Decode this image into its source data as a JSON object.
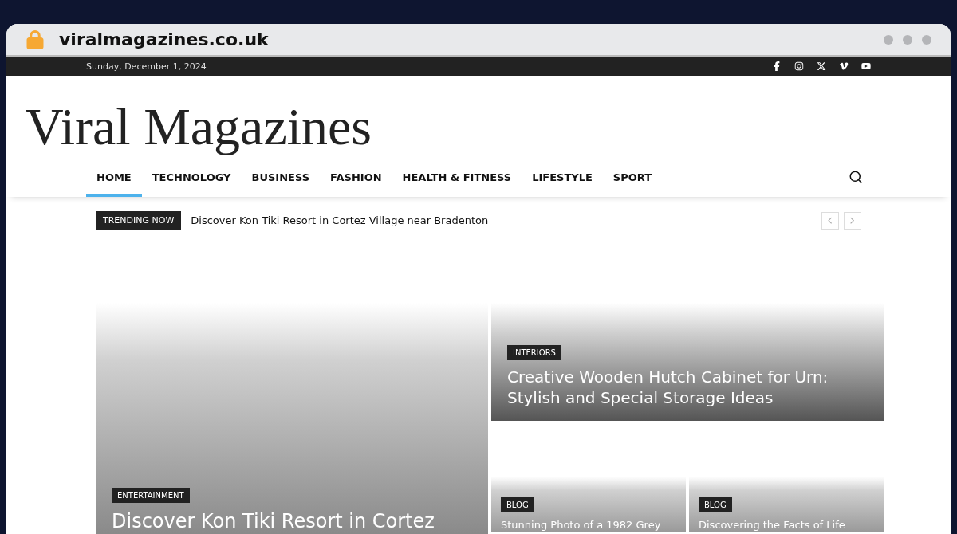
{
  "browser": {
    "address": "viralmagazines.co.uk"
  },
  "top_bar": {
    "date": "Sunday, December 1, 2024",
    "social": [
      {
        "kind": "facebook"
      },
      {
        "kind": "instagram"
      },
      {
        "kind": "x"
      },
      {
        "kind": "vimeo"
      },
      {
        "kind": "youtube"
      }
    ]
  },
  "logo": "Viral Magazines",
  "nav": [
    {
      "label": "HOME",
      "selected": true
    },
    {
      "label": "TECHNOLOGY",
      "selected": false
    },
    {
      "label": "BUSINESS",
      "selected": false
    },
    {
      "label": "FASHION",
      "selected": false
    },
    {
      "label": "HEALTH & FITNESS",
      "selected": false
    },
    {
      "label": "LIFESTYLE",
      "selected": false
    },
    {
      "label": "SPORT",
      "selected": false
    }
  ],
  "trending": {
    "badge": "TRENDING NOW",
    "headline": "Discover Kon Tiki Resort in Cortez Village near Bradenton"
  },
  "articles": [
    {
      "category": "ENTERTAINMENT",
      "title": "Discover Kon Tiki Resort in Cortez"
    },
    {
      "category": "INTERIORS",
      "title": "Creative Wooden Hutch Cabinet for Urn: Stylish and Special Storage Ideas"
    },
    {
      "category": "BLOG",
      "title": "Stunning Photo of a 1982 Grey"
    },
    {
      "category": "BLOG",
      "title": "Discovering the Facts of Life"
    }
  ]
}
